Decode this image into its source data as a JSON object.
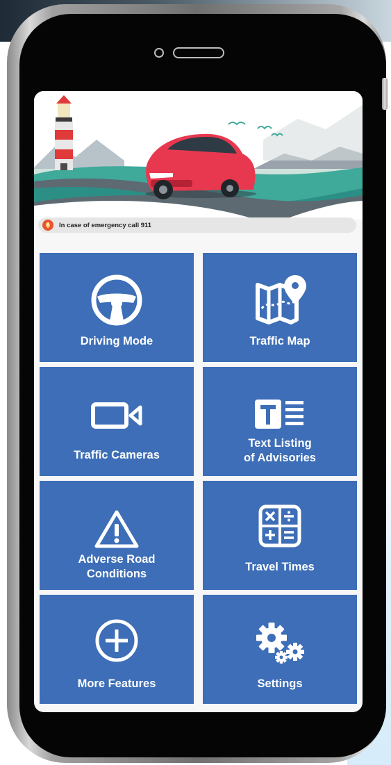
{
  "emergency": {
    "text": "In case of emergency call 911"
  },
  "tiles": [
    {
      "label": "Driving Mode",
      "icon": "steering-wheel-icon"
    },
    {
      "label": "Traffic Map",
      "icon": "map-pin-icon"
    },
    {
      "label": "Traffic Cameras",
      "icon": "video-camera-icon"
    },
    {
      "label_line1": "Text Listing",
      "label_line2": "of Advisories",
      "icon": "text-list-icon"
    },
    {
      "label_line1": "Adverse Road",
      "label_line2": "Conditions",
      "icon": "warning-icon"
    },
    {
      "label": "Travel Times",
      "icon": "calculator-icon"
    },
    {
      "label": "More Features",
      "icon": "plus-circle-icon"
    },
    {
      "label": "Settings",
      "icon": "gears-icon"
    }
  ],
  "colors": {
    "tile": "#3d6eb7",
    "screen": "#f7f7f7",
    "bell": "#e9542c",
    "car": "#e8384f"
  }
}
